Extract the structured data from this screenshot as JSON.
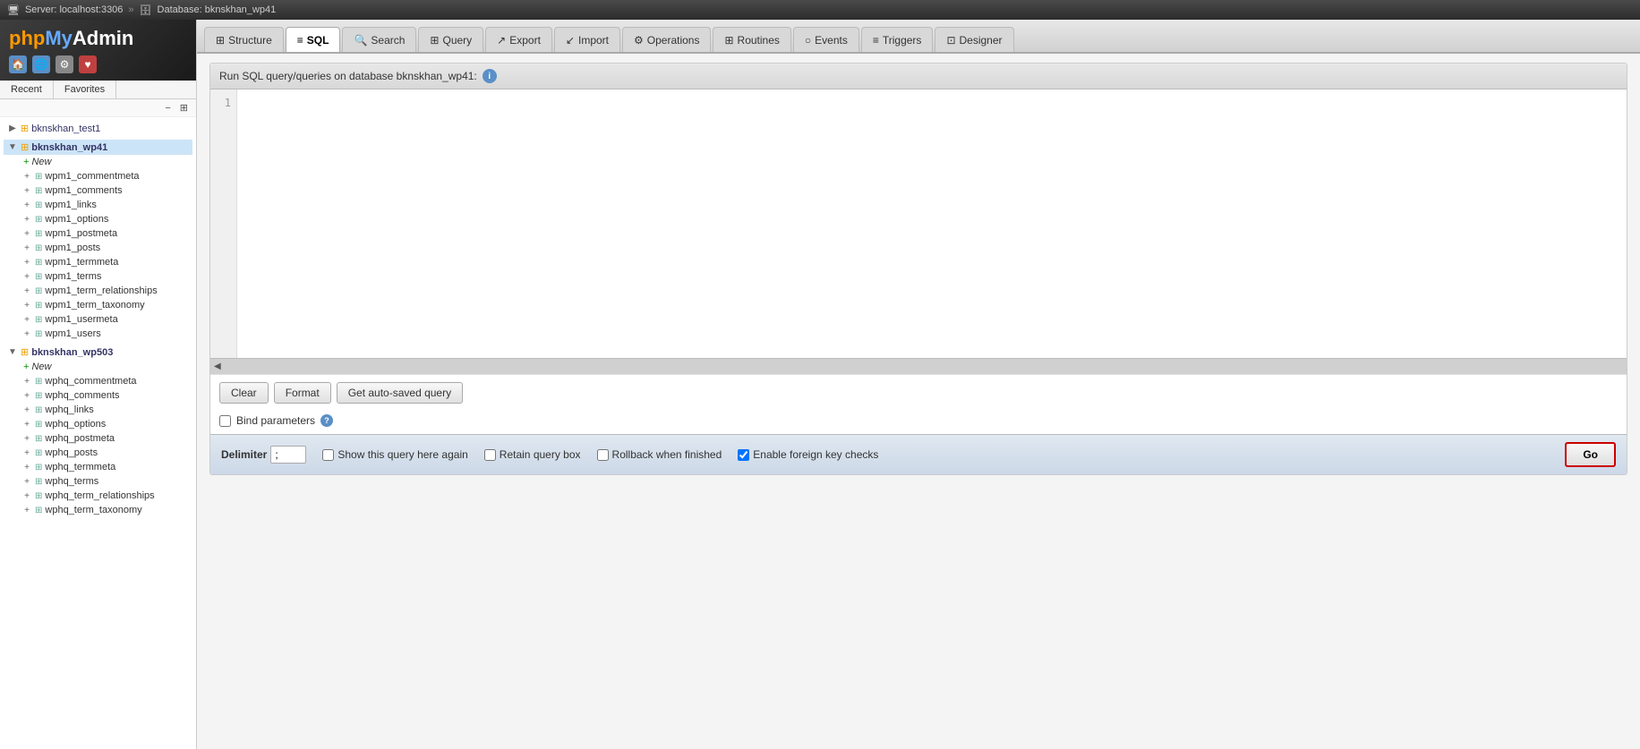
{
  "topbar": {
    "server_label": "Server: localhost:3306",
    "db_label": "Database: bknskhan_wp41",
    "server_icon": "🖥",
    "db_icon": "🗄"
  },
  "logo": {
    "text": "phpMyAdmin"
  },
  "sidebar": {
    "recent_tab": "Recent",
    "favorites_tab": "Favorites",
    "collapse_icon": "−",
    "expand_icon": "⊞",
    "databases": [
      {
        "name": "bknskhan_test1",
        "expanded": false,
        "tables": []
      },
      {
        "name": "bknskhan_wp41",
        "expanded": true,
        "active": true,
        "tables": [
          "wpm1_commentmeta",
          "wpm1_comments",
          "wpm1_links",
          "wpm1_options",
          "wpm1_postmeta",
          "wpm1_posts",
          "wpm1_termmeta",
          "wpm1_terms",
          "wpm1_term_relationships",
          "wpm1_term_taxonomy",
          "wpm1_usermeta",
          "wpm1_users"
        ]
      },
      {
        "name": "bknskhan_wp503",
        "expanded": true,
        "tables": [
          "wphq_commentmeta",
          "wphq_comments",
          "wphq_links",
          "wphq_options",
          "wphq_postmeta",
          "wphq_posts",
          "wphq_termmeta",
          "wphq_terms",
          "wphq_term_relationships",
          "wphq_term_taxonomy"
        ]
      }
    ],
    "new_label": "New"
  },
  "nav": {
    "tabs": [
      {
        "id": "structure",
        "label": "Structure",
        "icon": "⊞"
      },
      {
        "id": "sql",
        "label": "SQL",
        "icon": "≡",
        "active": true
      },
      {
        "id": "search",
        "label": "Search",
        "icon": "🔍"
      },
      {
        "id": "query",
        "label": "Query",
        "icon": "⊞"
      },
      {
        "id": "export",
        "label": "Export",
        "icon": "↗"
      },
      {
        "id": "import",
        "label": "Import",
        "icon": "↙"
      },
      {
        "id": "operations",
        "label": "Operations",
        "icon": "⚙"
      },
      {
        "id": "routines",
        "label": "Routines",
        "icon": "⊞"
      },
      {
        "id": "events",
        "label": "Events",
        "icon": "○"
      },
      {
        "id": "triggers",
        "label": "Triggers",
        "icon": "≡"
      },
      {
        "id": "designer",
        "label": "Designer",
        "icon": "⊡"
      }
    ]
  },
  "sql_panel": {
    "header": "Run SQL query/queries on database bknskhan_wp41:",
    "clear_btn": "Clear",
    "format_btn": "Format",
    "autosave_btn": "Get auto-saved query",
    "bind_params_label": "Bind parameters",
    "delimiter_label": "Delimiter",
    "delimiter_value": ";",
    "show_query_label": "Show this query here again",
    "retain_box_label": "Retain query box",
    "rollback_label": "Rollback when finished",
    "foreign_key_label": "Enable foreign key checks",
    "go_btn": "Go",
    "line_number": "1"
  }
}
